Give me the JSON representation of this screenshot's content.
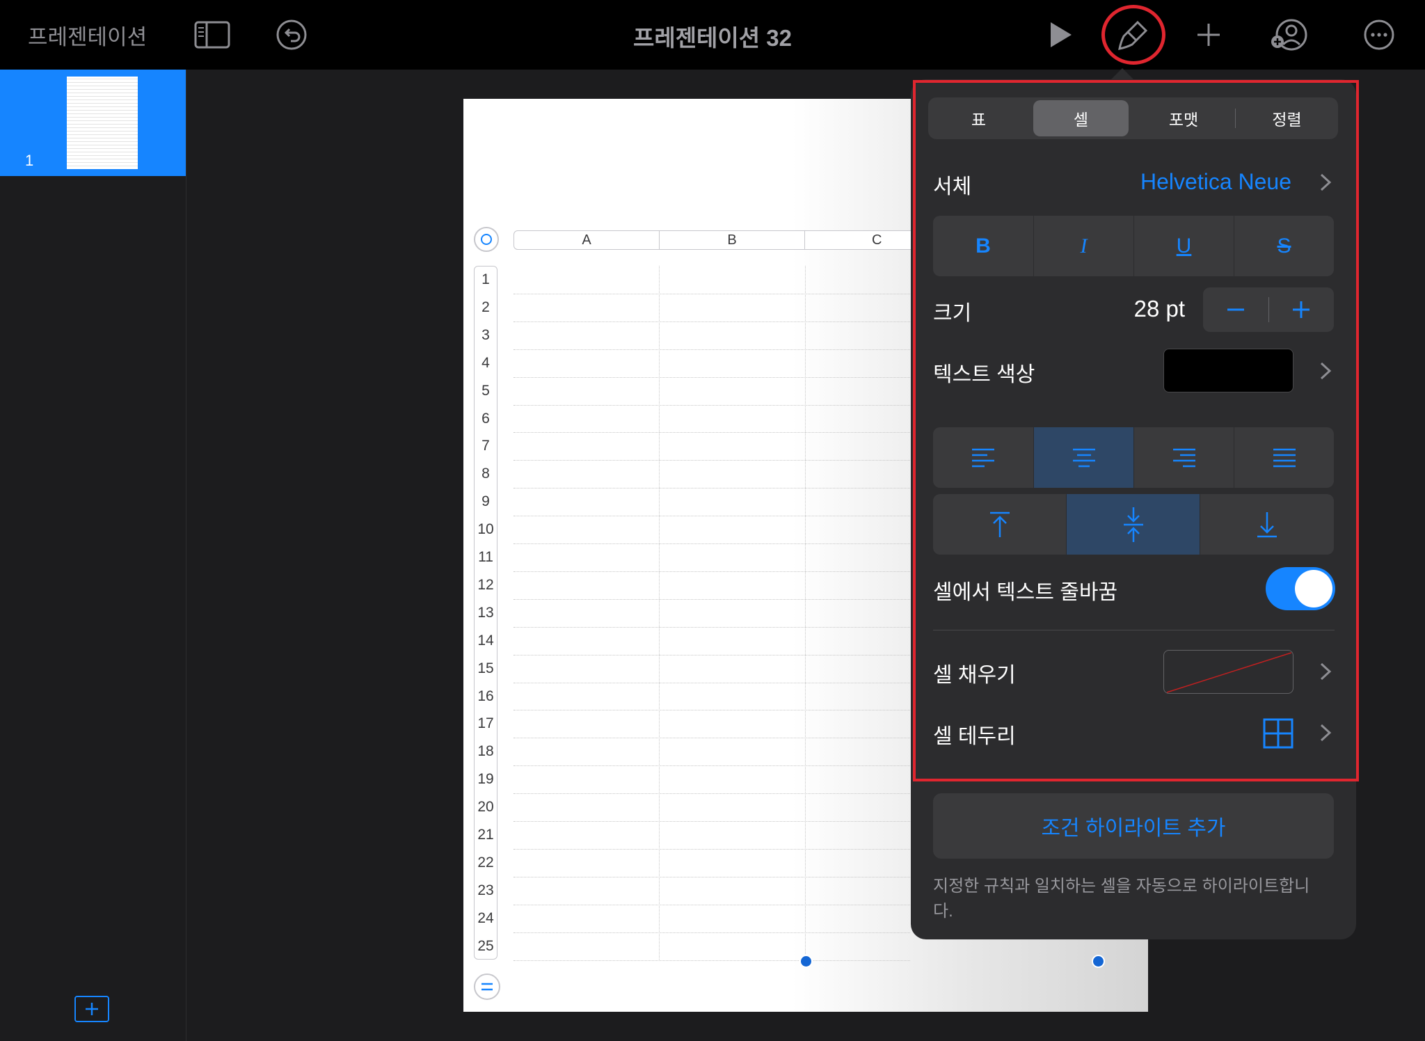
{
  "topbar": {
    "app_title": "프레젠테이션",
    "doc_title": "프레젠테이션 32",
    "icons": [
      "sidebar-icon",
      "undo-icon",
      "play-icon",
      "format-brush-icon",
      "add-icon",
      "collaborate-icon",
      "more-icon"
    ]
  },
  "sidebar": {
    "slides": [
      {
        "number": "1"
      }
    ]
  },
  "table": {
    "columns": [
      "A",
      "B",
      "C"
    ],
    "rows": [
      "1",
      "2",
      "3",
      "4",
      "5",
      "6",
      "7",
      "8",
      "9",
      "10",
      "11",
      "12",
      "13",
      "14",
      "15",
      "16",
      "17",
      "18",
      "19",
      "20",
      "21",
      "22",
      "23",
      "24",
      "25"
    ]
  },
  "panel": {
    "tabs": [
      {
        "label": "표",
        "active": false
      },
      {
        "label": "셀",
        "active": true
      },
      {
        "label": "포맷",
        "active": false
      },
      {
        "label": "정렬",
        "active": false
      }
    ],
    "font_label": "서체",
    "font_value": "Helvetica Neue",
    "styles": {
      "bold": "B",
      "italic": "I",
      "underline": "U",
      "strike": "S"
    },
    "size_label": "크기",
    "size_value": "28 pt",
    "text_color_label": "텍스트 색상",
    "text_color": "#000000",
    "horizontal_align_selected": "center",
    "vertical_align_selected": "middle",
    "wrap_label": "셀에서 텍스트 줄바꿈",
    "wrap_on": true,
    "fill_label": "셀 채우기",
    "border_label": "셀 테두리",
    "conditional_button": "조건 하이라이트 추가",
    "conditional_desc": "지정한 규칙과 일치하는 셀을 자동으로 하이라이트합니다."
  },
  "colors": {
    "accent": "#1685ff",
    "highlight": "#e0262f",
    "panel_bg": "#2c2c2e"
  }
}
